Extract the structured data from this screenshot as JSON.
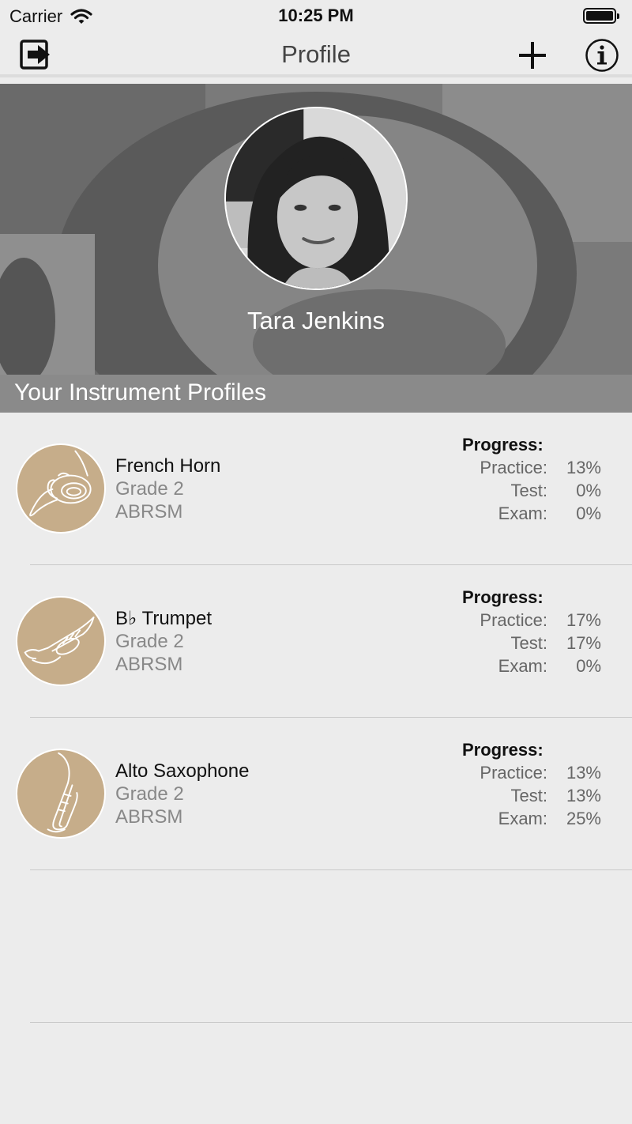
{
  "status_bar": {
    "carrier": "Carrier",
    "time": "10:25 PM"
  },
  "nav": {
    "title": "Profile",
    "icons": {
      "left": "exit-icon",
      "add": "plus-icon",
      "info": "info-icon"
    }
  },
  "profile": {
    "name": "Tara Jenkins"
  },
  "section": {
    "title": "Your Instrument Profiles"
  },
  "colors": {
    "accent": "#c6ad8a",
    "section_bg": "#8a8a8a",
    "background": "#ececec"
  },
  "instruments": [
    {
      "name": "French Horn",
      "grade": "Grade 2",
      "board": "ABRSM",
      "icon": "french-horn-icon",
      "progress_title": "Progress:",
      "practice_label": "Practice:",
      "practice": "13%",
      "test_label": "Test:",
      "test": "0%",
      "exam_label": "Exam:",
      "exam": "0%"
    },
    {
      "name": "B♭ Trumpet",
      "grade": "Grade 2",
      "board": "ABRSM",
      "icon": "trumpet-icon",
      "progress_title": "Progress:",
      "practice_label": "Practice:",
      "practice": "17%",
      "test_label": "Test:",
      "test": "17%",
      "exam_label": "Exam:",
      "exam": "0%"
    },
    {
      "name": "Alto Saxophone",
      "grade": "Grade 2",
      "board": "ABRSM",
      "icon": "saxophone-icon",
      "progress_title": "Progress:",
      "practice_label": "Practice:",
      "practice": "13%",
      "test_label": "Test:",
      "test": "13%",
      "exam_label": "Exam:",
      "exam": "25%"
    }
  ]
}
